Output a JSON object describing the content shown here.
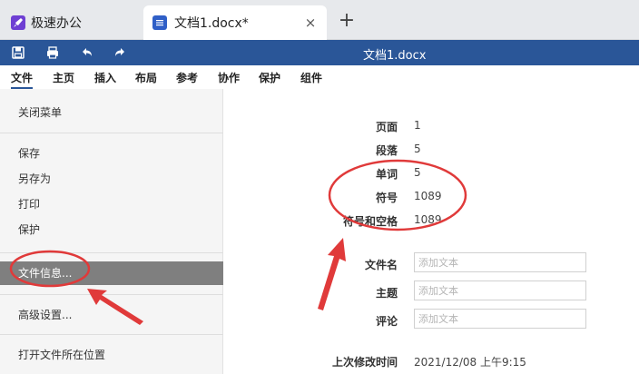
{
  "tabs": {
    "home_label": "极速办公",
    "doc_label": "文档1.docx*",
    "close_glyph": "×",
    "add_glyph": "+"
  },
  "toolbar": {
    "doc_title": "文档1.docx"
  },
  "menu": {
    "items": [
      "文件",
      "主页",
      "插入",
      "布局",
      "参考",
      "协作",
      "保护",
      "组件"
    ]
  },
  "sidebar": {
    "items": [
      "关闭菜单",
      "保存",
      "另存为",
      "打印",
      "保护",
      "文件信息...",
      "高级设置...",
      "打开文件所在位置"
    ],
    "selected": "文件信息..."
  },
  "stats": [
    {
      "label": "页面",
      "value": "1"
    },
    {
      "label": "段落",
      "value": "5"
    },
    {
      "label": "单词",
      "value": "5"
    },
    {
      "label": "符号",
      "value": "1089"
    },
    {
      "label": "符号和空格",
      "value": "1089"
    }
  ],
  "fields": [
    {
      "label": "文件名",
      "placeholder": "添加文本"
    },
    {
      "label": "主题",
      "placeholder": "添加文本"
    },
    {
      "label": "评论",
      "placeholder": "添加文本"
    }
  ],
  "last_modified": {
    "label": "上次修改时间",
    "value": "2021/12/08 上午9:15"
  },
  "colors": {
    "toolbar_blue": "#2a5698",
    "annotation_red": "#e03a3a"
  }
}
